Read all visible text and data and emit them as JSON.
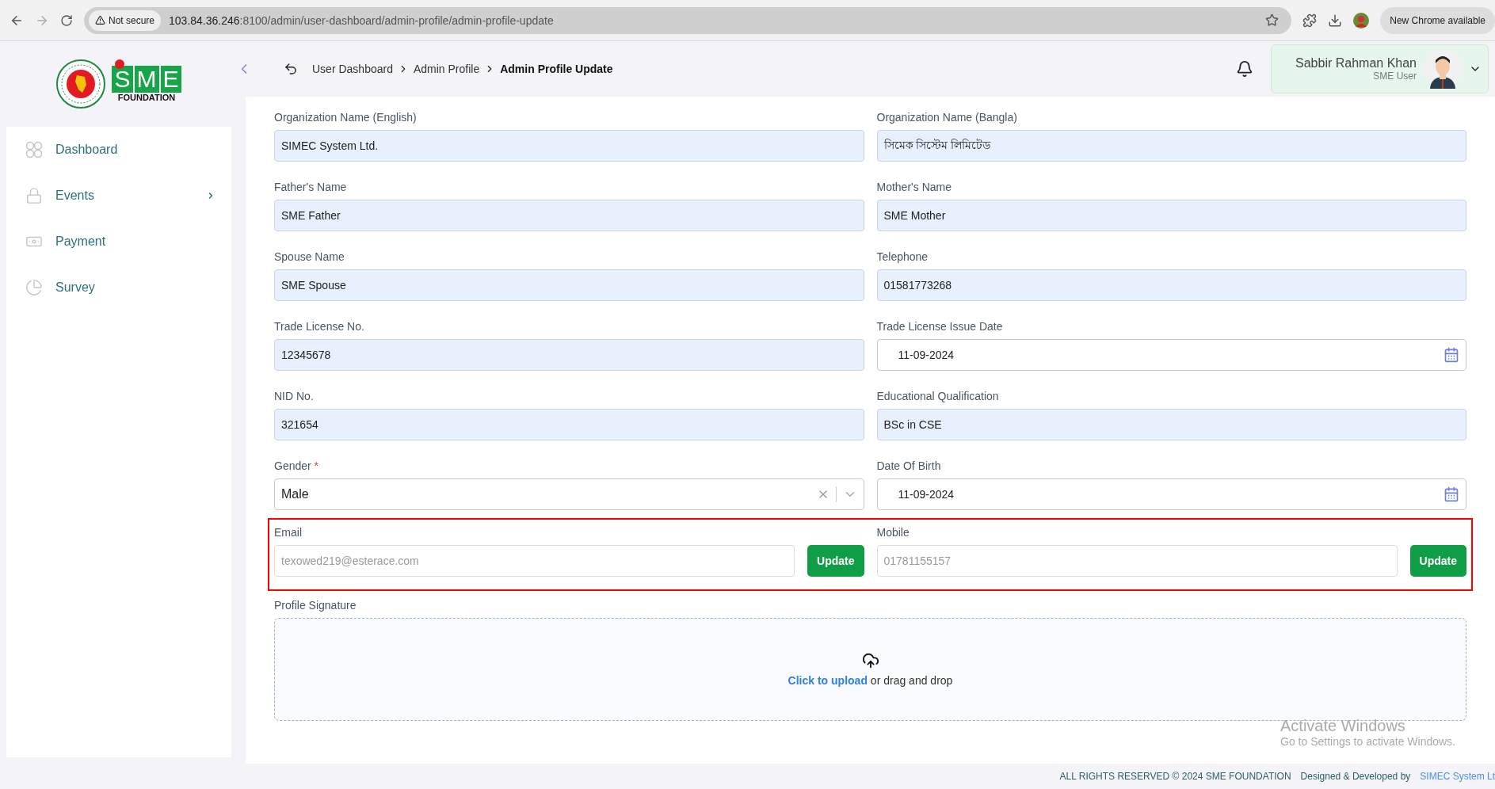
{
  "browser": {
    "security": "Not secure",
    "url_host": "103.84.36.246",
    "url_path": ":8100/admin/user-dashboard/admin-profile/admin-profile-update",
    "update_notice": "New Chrome available"
  },
  "logo": {
    "letters": [
      "S",
      "M",
      "E"
    ],
    "caption": "FOUNDATION"
  },
  "sidebar": {
    "items": [
      {
        "label": "Dashboard",
        "kind": "grid",
        "has_children": false
      },
      {
        "label": "Events",
        "kind": "lock",
        "has_children": true
      },
      {
        "label": "Payment",
        "kind": "money",
        "has_children": false
      },
      {
        "label": "Survey",
        "kind": "pie",
        "has_children": false
      }
    ]
  },
  "breadcrumb": [
    "User Dashboard",
    "Admin Profile",
    "Admin Profile Update"
  ],
  "user": {
    "name": "Sabbir Rahman Khan",
    "role": "SME User"
  },
  "form": {
    "fields": [
      {
        "label": "Organization Name (English)",
        "value": "SIMEC System Ltd.",
        "kind": "text"
      },
      {
        "label": "Organization Name (Bangla)",
        "value": "সিমেক সিস্টেম লিমিটেড",
        "kind": "text"
      },
      {
        "label": "Father's Name",
        "value": "SME Father",
        "kind": "text"
      },
      {
        "label": "Mother's Name",
        "value": "SME Mother",
        "kind": "text"
      },
      {
        "label": "Spouse Name",
        "value": "SME Spouse",
        "kind": "text"
      },
      {
        "label": "Telephone",
        "value": "01581773268",
        "kind": "text"
      },
      {
        "label": "Trade License No.",
        "value": "12345678",
        "kind": "text"
      },
      {
        "label": "Trade License Issue Date",
        "value": "11-09-2024",
        "kind": "date"
      },
      {
        "label": "NID No.",
        "value": "321654",
        "kind": "text"
      },
      {
        "label": "Educational Qualification",
        "value": "BSc in CSE",
        "kind": "text"
      },
      {
        "label": "Gender",
        "value": "Male",
        "kind": "select",
        "required": true,
        "required_mark": "*"
      },
      {
        "label": "Date Of Birth",
        "value": "11-09-2024",
        "kind": "date"
      }
    ],
    "contact": [
      {
        "label": "Email",
        "placeholder": "texowed219@esterace.com",
        "button": "Update"
      },
      {
        "label": "Mobile",
        "placeholder": "01781155157",
        "button": "Update"
      }
    ],
    "signature": {
      "label": "Profile Signature",
      "link": "Click to upload",
      "rest": "or drag and drop"
    }
  },
  "windows_notice": {
    "title": "Activate Windows",
    "subtitle": "Go to Settings to activate Windows."
  },
  "footer": {
    "rights": "ALL RIGHTS RESERVED © 2024 SME FOUNDATION",
    "credit": "Designed & Developed by",
    "company": "SIMEC System Lt"
  }
}
